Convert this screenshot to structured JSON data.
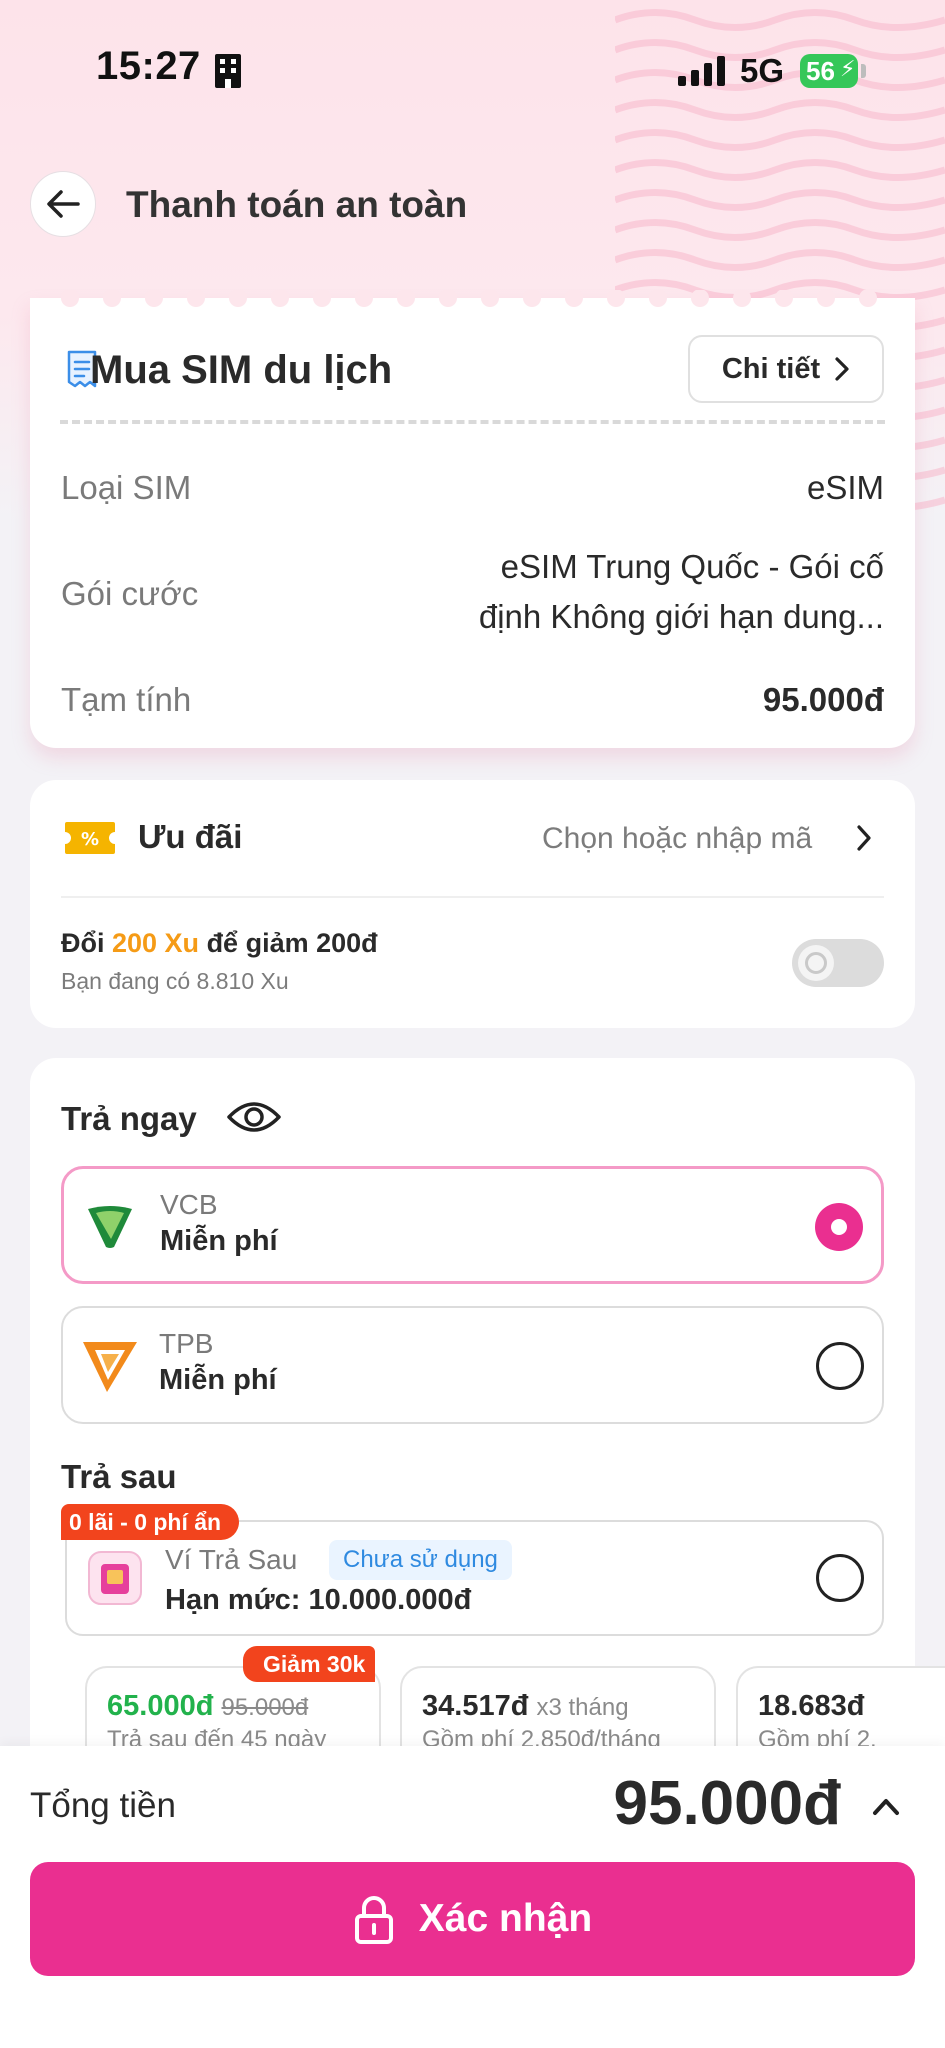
{
  "status_bar": {
    "time": "15:27",
    "network": "5G",
    "battery": "56"
  },
  "header": {
    "title": "Thanh toán an toàn"
  },
  "order": {
    "title": "Mua SIM du lịch",
    "detail_button": "Chi tiết",
    "rows": [
      {
        "label": "Loại SIM",
        "value": "eSIM"
      },
      {
        "label": "Gói cước",
        "value_line1": "eSIM Trung Quốc - Gói cố",
        "value_line2": "định Không giới hạn dung..."
      },
      {
        "label": "Tạm tính",
        "value": "95.000đ"
      }
    ]
  },
  "promo": {
    "title": "Ưu đãi",
    "pick_label": "Chọn hoặc nhập mã",
    "xu_prefix": "Đổi ",
    "xu_amount": "200 Xu",
    "xu_suffix": " để giảm 200đ",
    "xu_balance": "Bạn đang có 8.810 Xu",
    "toggle_on": false
  },
  "payment": {
    "pay_now_title": "Trả ngay",
    "banks": [
      {
        "name": "VCB",
        "fee": "Miễn phí",
        "selected": true
      },
      {
        "name": "TPB",
        "fee": "Miễn phí",
        "selected": false
      }
    ],
    "pay_later_title": "Trả sau",
    "pay_later_badge": "0 lãi - 0 phí ẩn",
    "wallet": {
      "name": "Ví Trả Sau",
      "tag": "Chưa sử dụng",
      "limit": "Hạn mức: 10.000.000đ"
    },
    "plans": [
      {
        "badge": "Giảm 30k",
        "price": "65.000đ",
        "old_price": "95.000đ",
        "sub": "Trả sau đến 45 ngày"
      },
      {
        "price": "34.517đ",
        "term": "x3 tháng",
        "sub": "Gồm phí 2.850đ/tháng"
      },
      {
        "price": "18.683đ",
        "sub": "Gồm phí 2."
      }
    ]
  },
  "footer": {
    "total_label": "Tổng tiền",
    "total_value": "95.000đ",
    "confirm_label": "Xác nhận"
  },
  "colors": {
    "accent": "#ea2f90",
    "promo_orange": "#f59b16",
    "badge_red": "#f2441d",
    "price_green": "#22b24c"
  }
}
